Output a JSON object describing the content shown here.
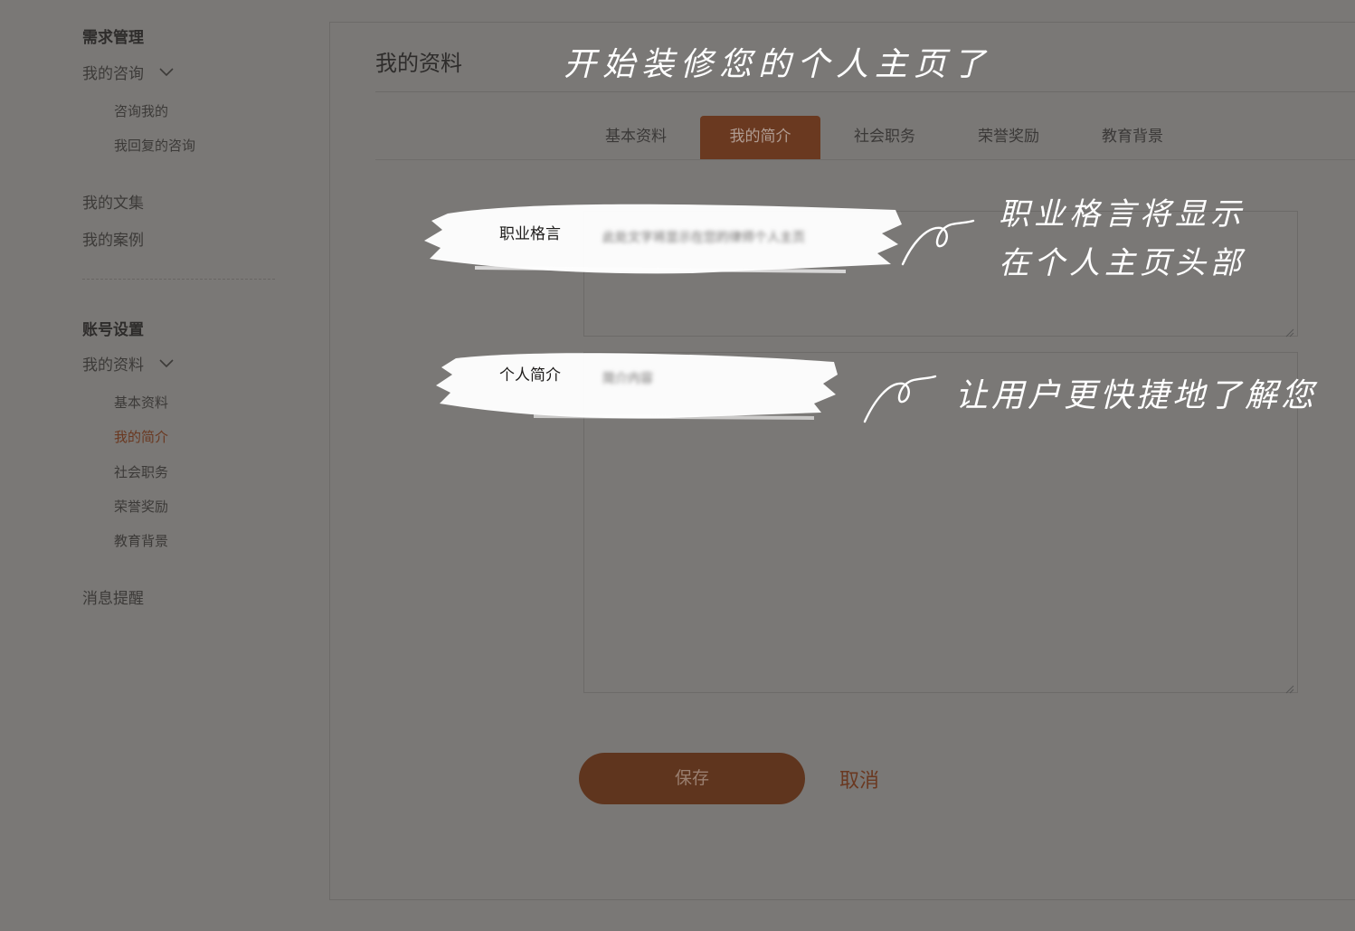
{
  "sidebar": {
    "group1": "需求管理",
    "my_consults": "我的咨询",
    "consults_to_me": "咨询我的",
    "my_replied": "我回复的咨询",
    "my_articles": "我的文集",
    "my_cases": "我的案例",
    "group2": "账号设置",
    "my_profile": "我的资料",
    "basic_info": "基本资料",
    "my_intro": "我的简介",
    "social_duties": "社会职务",
    "honors": "荣誉奖励",
    "education": "教育背景",
    "notifications": "消息提醒"
  },
  "main": {
    "title": "我的资料",
    "tabs": [
      {
        "label": "基本资料",
        "active": false
      },
      {
        "label": "我的简介",
        "active": true
      },
      {
        "label": "社会职务",
        "active": false
      },
      {
        "label": "荣誉奖励",
        "active": false
      },
      {
        "label": "教育背景",
        "active": false
      }
    ],
    "motto": {
      "label": "职业格言",
      "value": "此处文字将显示在您的律师个人主页"
    },
    "intro": {
      "label": "个人简介",
      "value": "简介内容"
    },
    "save_label": "保存",
    "cancel_label": "取消"
  },
  "annotations": {
    "top": "开始装修您的个人主页了",
    "motto_line1": "职业格言将显示",
    "motto_line2": "在个人主页头部",
    "intro": "让用户更快捷地了解您"
  },
  "colors": {
    "overlay": "#7a7876",
    "accent": "#6a3920",
    "save_bg": "#5f351e"
  }
}
